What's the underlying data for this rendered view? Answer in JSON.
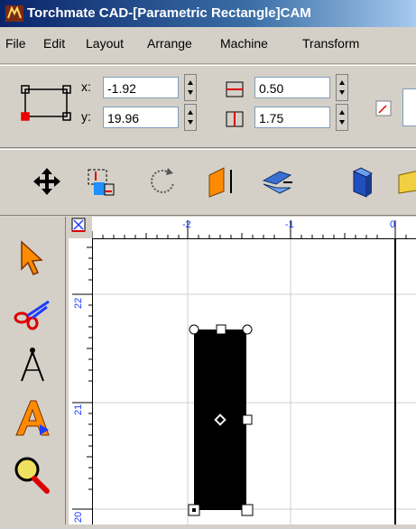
{
  "window": {
    "title": "Torchmate CAD-[Parametric Rectangle]CAM"
  },
  "menu": {
    "items": [
      "File",
      "Edit",
      "Layout",
      "Arrange",
      "Machine",
      "Transform"
    ]
  },
  "properties": {
    "x_label": "x:",
    "x_value": "-1.92",
    "y_label": "y:",
    "y_value": "19.96",
    "height_value": "0.50",
    "width_value": "1.75"
  },
  "ruler": {
    "h_labels": [
      "-2",
      "-1",
      "0"
    ],
    "v_labels": [
      "22",
      "21",
      "20"
    ]
  },
  "icons": {
    "toolbar": [
      "move-icon",
      "node-select-icon",
      "rotate-icon",
      "skew-icon",
      "mirror-icon",
      "extrude-icon",
      "cut-icon"
    ],
    "toolbox": [
      "pointer-tool-icon",
      "scissors-tool-icon",
      "compass-tool-icon",
      "text-tool-icon",
      "zoom-tool-icon"
    ]
  },
  "colors": {
    "titlebar": "#0a246a",
    "accent": "#1e40ff",
    "object_fill": "#000000"
  }
}
